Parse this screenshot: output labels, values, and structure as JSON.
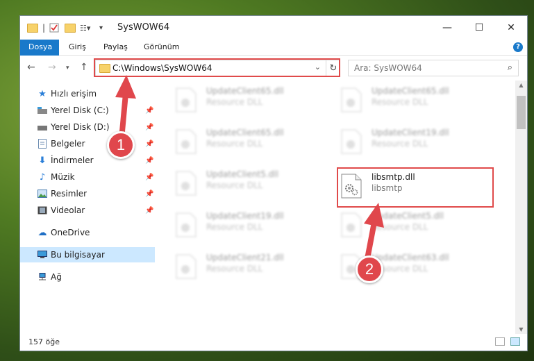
{
  "window": {
    "title": "SysWOW64",
    "ribbon_tabs": [
      "Dosya",
      "Giriş",
      "Paylaş",
      "Görünüm"
    ],
    "help_label": "?"
  },
  "address": {
    "path": "C:\\Windows\\SysWOW64",
    "search_placeholder": "Ara: SysWOW64"
  },
  "nav": {
    "items": [
      {
        "label": "Hızlı erişim",
        "icon": "star-icon"
      },
      {
        "label": "Yerel Disk (C:)",
        "icon": "drive-icon"
      },
      {
        "label": "Yerel Disk (D:)",
        "icon": "drive-icon"
      },
      {
        "label": "Belgeler",
        "icon": "document-icon"
      },
      {
        "label": "İndirmeler",
        "icon": "download-icon"
      },
      {
        "label": "Müzik",
        "icon": "music-icon"
      },
      {
        "label": "Resimler",
        "icon": "pictures-icon"
      },
      {
        "label": "Videolar",
        "icon": "video-icon"
      },
      {
        "label": "OneDrive",
        "icon": "cloud-icon"
      },
      {
        "label": "Bu bilgisayar",
        "icon": "computer-icon"
      },
      {
        "label": "Ağ",
        "icon": "network-icon"
      }
    ]
  },
  "files": [
    {
      "name": "UpdateClient65.dll",
      "type": "Resource DLL"
    },
    {
      "name": "UpdateClient65.dll",
      "type": "Resource DLL"
    },
    {
      "name": "UpdateClient65.dll",
      "type": "Resource DLL"
    },
    {
      "name": "UpdateClient19.dll",
      "type": "Resource DLL"
    },
    {
      "name": "UpdateClient5.dll",
      "type": "Resource DLL"
    },
    {
      "name": "libsmtp.dll",
      "type": "libsmtp"
    },
    {
      "name": "UpdateClient19.dll",
      "type": "Resource DLL"
    },
    {
      "name": "UpdateClient5.dll",
      "type": "Resource DLL"
    },
    {
      "name": "UpdateClient21.dll",
      "type": "Resource DLL"
    },
    {
      "name": "UpdateClient63.dll",
      "type": "Resource DLL"
    }
  ],
  "status": {
    "count_text": "157 öğe"
  },
  "callouts": {
    "step1": "1",
    "step2": "2"
  },
  "colors": {
    "accent": "#1979ca",
    "highlight": "#e04a4a",
    "selected": "#cce8ff"
  }
}
